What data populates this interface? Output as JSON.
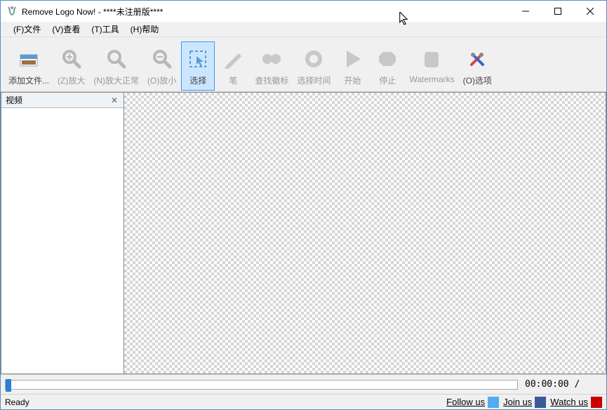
{
  "window": {
    "title": "Remove Logo Now! - ****未注册版****"
  },
  "menu": {
    "file": "(F)文件",
    "view": "(V)查看",
    "tools": "(T)工具",
    "help": "(H)帮助"
  },
  "toolbar": {
    "addfile": "添加文件...",
    "zoomin": "(Z)放大",
    "zoomnormal": "(N)放大正常",
    "zoomout": "(O)放小",
    "select": "选择",
    "pen": "笔",
    "findlogo": "查找徽标",
    "selecttime": "选择时间",
    "start": "开始",
    "stop": "停止",
    "watermarks": "Watermarks",
    "options": "(O)选项"
  },
  "panel": {
    "title": "视频"
  },
  "timeline": {
    "time": "00:00:00 /"
  },
  "status": {
    "ready": "Ready",
    "follow": "Follow us",
    "join": "Join us",
    "watch": "Watch us"
  }
}
